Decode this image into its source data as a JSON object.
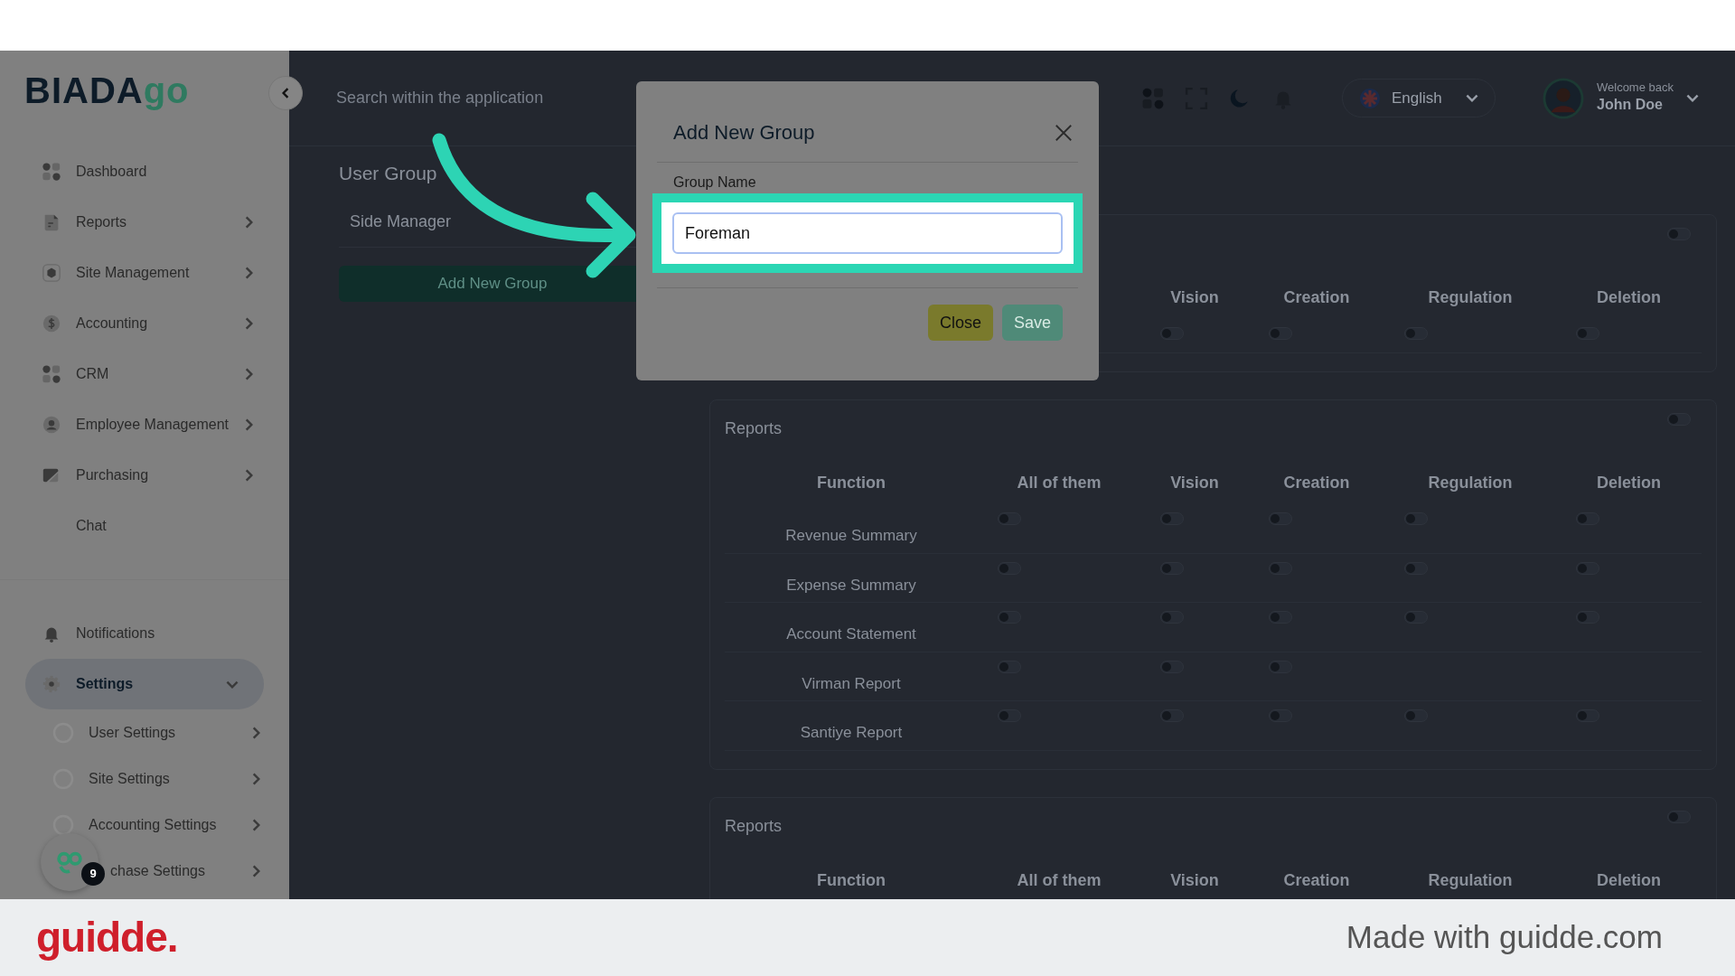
{
  "logo": {
    "text": "BIADA",
    "accent": "go"
  },
  "sidebar": {
    "items": [
      {
        "label": "Dashboard",
        "submenu": false,
        "selected": false
      },
      {
        "label": "Reports",
        "submenu": true,
        "selected": false
      },
      {
        "label": "Site Management",
        "submenu": true,
        "selected": false
      },
      {
        "label": "Accounting",
        "submenu": true,
        "selected": false
      },
      {
        "label": "CRM",
        "submenu": true,
        "selected": false
      },
      {
        "label": "Employee Management",
        "submenu": true,
        "selected": false
      },
      {
        "label": "Purchasing",
        "submenu": true,
        "selected": false
      },
      {
        "label": "Chat",
        "submenu": false,
        "selected": false
      }
    ],
    "bottom_items": [
      {
        "label": "Notifications",
        "submenu": false,
        "selected": false
      },
      {
        "label": "Settings",
        "submenu": true,
        "selected": true,
        "expanded": true,
        "children": [
          {
            "label": "User Settings"
          },
          {
            "label": "Site Settings"
          },
          {
            "label": "Accounting Settings"
          },
          {
            "label": "chase Settings"
          }
        ]
      }
    ]
  },
  "header": {
    "search": {
      "placeholder": "Search within the application"
    },
    "language": "English",
    "user": {
      "greeting": "Welcome back",
      "name": "John Doe"
    }
  },
  "groups_panel": {
    "title": "User Group",
    "groups": [
      {
        "name": "Side Manager"
      }
    ],
    "add_button": "Add New Group"
  },
  "permission_sections": [
    {
      "master_on": false,
      "columns": [
        "Vision",
        "Creation",
        "Regulation",
        "Deletion"
      ],
      "rows": [
        {
          "toggles": [
            false,
            false,
            false,
            false
          ]
        }
      ]
    },
    {
      "title": "Reports",
      "master_on": false,
      "columns": [
        "Function",
        "All of them",
        "Vision",
        "Creation",
        "Regulation",
        "Deletion"
      ],
      "rows": [
        {
          "function": "Revenue Summary",
          "toggles": [
            false,
            false,
            false,
            false,
            false
          ]
        },
        {
          "function": "Expense Summary",
          "toggles": [
            false,
            false,
            false,
            false,
            false
          ]
        },
        {
          "function": "Account Statement",
          "toggles": [
            false,
            false,
            false,
            false,
            false
          ]
        },
        {
          "function": "Virman Report",
          "toggles": [
            false,
            false,
            false
          ]
        },
        {
          "function": "Santiye Report",
          "toggles": [
            false,
            false,
            false,
            false,
            false
          ]
        }
      ]
    },
    {
      "title": "Reports",
      "master_on": false,
      "columns": [
        "Function",
        "All of them",
        "Vision",
        "Creation",
        "Regulation",
        "Deletion"
      ]
    }
  ],
  "modal": {
    "title": "Add New Group",
    "field_label": "Group Name",
    "field_value": "Foreman",
    "buttons": [
      {
        "label": "Close",
        "kind": "secondary"
      },
      {
        "label": "Save",
        "kind": "primary"
      }
    ]
  },
  "chat_bubble": {
    "badge": "9"
  },
  "footer": {
    "brand": "guidde.",
    "credit": "Made with guidde.com"
  }
}
